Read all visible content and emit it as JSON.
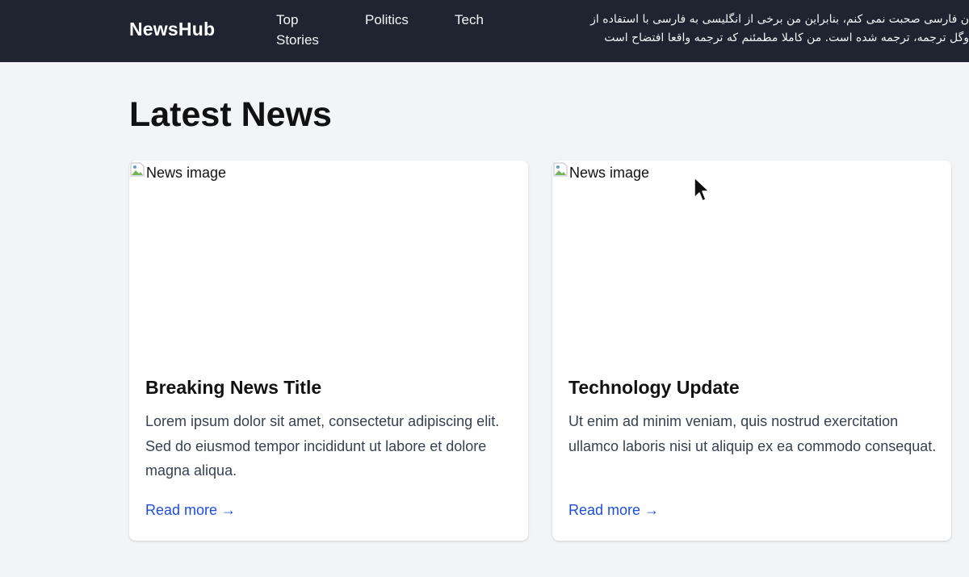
{
  "header": {
    "logo": "NewsHub",
    "nav": [
      {
        "label": "Top Stories"
      },
      {
        "label": "Politics"
      },
      {
        "label": "Tech"
      }
    ],
    "notice_lines": [
      "ن فارسی صحبت نمی کنم، بنابراین من برخی از انگلیسی به فارسی با استفاده از",
      "وگل ترجمه، ترجمه شده است. من کاملا مطمئنم که ترجمه واقعا افتضاح است"
    ]
  },
  "main": {
    "title": "Latest News",
    "cards": [
      {
        "image_alt": "News image",
        "title": "Breaking News Title",
        "text": "Lorem ipsum dolor sit amet, consectetur adipiscing elit. Sed do eiusmod tempor incididunt ut labore et dolore magna aliqua.",
        "link": "Read more →"
      },
      {
        "image_alt": "News image",
        "title": "Technology Update",
        "text": "Ut enim ad minim veniam, quis nostrud exercitation ullamco laboris nisi ut aliquip ex ea commodo consequat.",
        "link": "Read more →"
      }
    ]
  },
  "icons": {
    "broken_image": "broken-image-icon",
    "cursor": "mouse-pointer-icon"
  },
  "colors": {
    "header_bg": "#1f2430",
    "page_bg": "#f3f4f6",
    "link": "#1d4ed8"
  }
}
